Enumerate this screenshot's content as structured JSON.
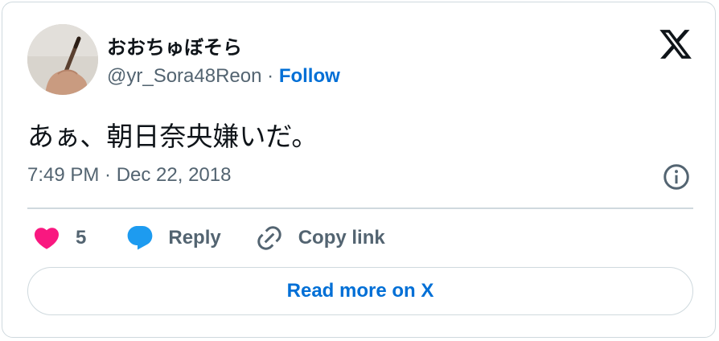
{
  "user": {
    "display_name": "おおちゅぼそら",
    "handle": "@yr_Sora48Reon",
    "separator": "·",
    "follow_label": "Follow",
    "avatar_icon": "hand-holding-pen-avatar"
  },
  "brand": {
    "logo_icon": "x-logo-icon"
  },
  "tweet": {
    "text": "あぁ、朝日奈央嫌いだ。",
    "timestamp": "7:49 PM · Dec 22, 2018"
  },
  "actions": {
    "like_count": "5",
    "reply_label": "Reply",
    "copy_link_label": "Copy link"
  },
  "footer": {
    "read_more_label": "Read more on X"
  },
  "colors": {
    "link_blue": "#006fd6",
    "like_pink": "#f91880",
    "reply_blue": "#1d9bf0",
    "muted_text": "#536471",
    "primary_text": "#0f1419",
    "border": "#cfd9de"
  }
}
